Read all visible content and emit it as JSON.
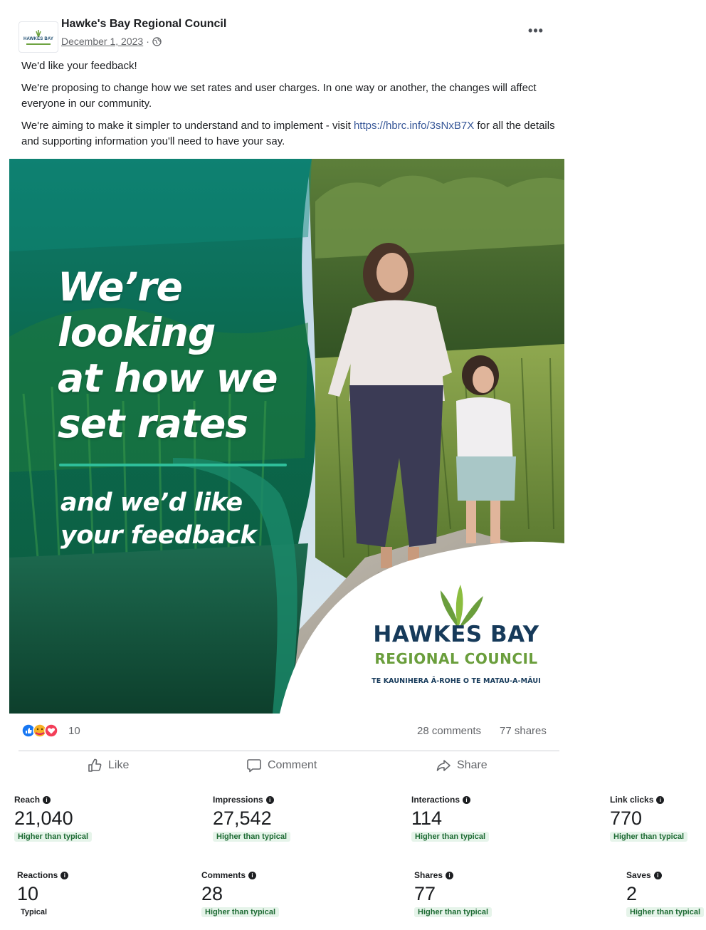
{
  "post": {
    "page_name": "Hawke's Bay Regional Council",
    "logo_text": "HAWKES BAY",
    "date": "December 1, 2023",
    "separator": "·",
    "more_label": "•••",
    "paragraphs": [
      "We'd like your feedback!",
      "We're proposing to change how we set rates and user charges. In one way or another, the changes will affect everyone in our community."
    ],
    "paragraph3_before": "We're aiming to make it simpler to understand and to implement - visit ",
    "link": "https://hbrc.info/3sNxB7X",
    "paragraph3_after": " for all the details and supporting information you'll need to have your say."
  },
  "image": {
    "headline": [
      "We’re",
      "looking",
      "at how we",
      "set rates"
    ],
    "subline": [
      "and we’d like",
      "your feedback"
    ],
    "logo_name": "HAWKES BAY",
    "logo_sub": "REGIONAL COUNCIL",
    "logo_maori": "TE KAUNIHERA Ā-ROHE O TE MATAU-A-MĀUI"
  },
  "engagement": {
    "reactions": "10",
    "comments": "28 comments",
    "shares": "77 shares"
  },
  "actions": {
    "like": "Like",
    "comment": "Comment",
    "share": "Share"
  },
  "metrics": [
    {
      "label": "Reach",
      "value": "21,040",
      "status": "Higher than typical"
    },
    {
      "label": "Impressions",
      "value": "27,542",
      "status": "Higher than typical"
    },
    {
      "label": "Interactions",
      "value": "114",
      "status": "Higher than typical"
    },
    {
      "label": "Link clicks",
      "value": "770",
      "status": "Higher than typical"
    },
    {
      "label": "Reactions",
      "value": "10",
      "status": "Typical"
    },
    {
      "label": "Comments",
      "value": "28",
      "status": "Higher than typical"
    },
    {
      "label": "Shares",
      "value": "77",
      "status": "Higher than typical"
    },
    {
      "label": "Saves",
      "value": "2",
      "status": "Higher than typical"
    }
  ],
  "colors": {
    "brand_navy": "#163a5a",
    "brand_green": "#6a9e3c",
    "link": "#385898",
    "badge_green": "#1e6b34"
  }
}
